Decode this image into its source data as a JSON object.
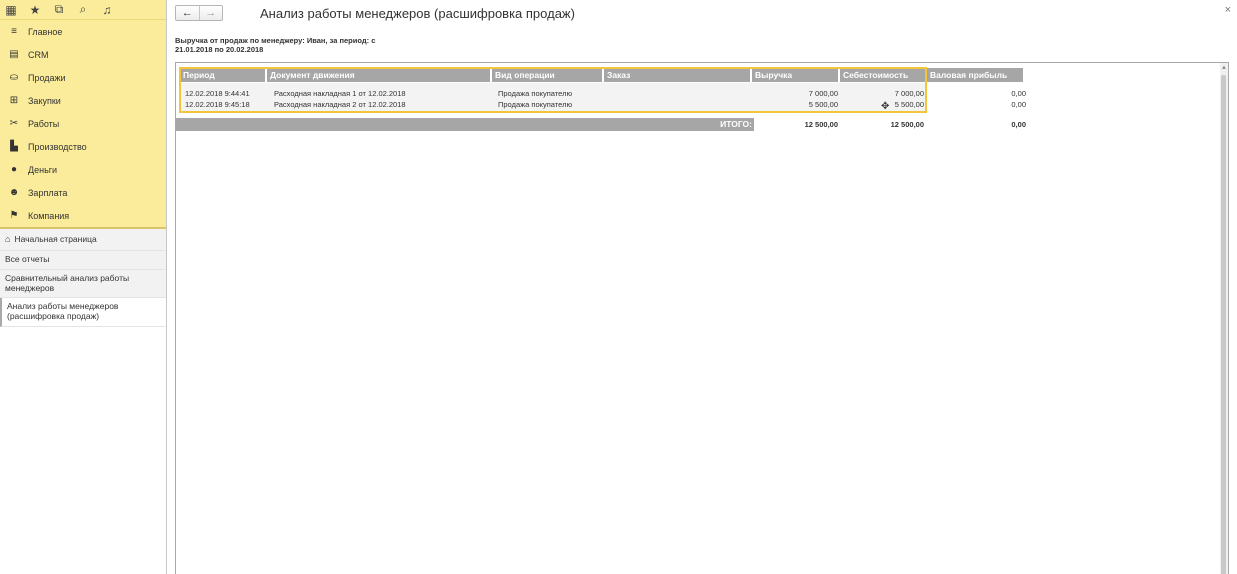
{
  "topbar": {
    "icons": [
      "apps-grid-icon",
      "star-icon",
      "history-icon",
      "search-icon",
      "bell-icon"
    ]
  },
  "sidebar": {
    "sections": [
      {
        "label": "Главное",
        "icon": "menu-icon"
      },
      {
        "label": "CRM",
        "icon": "crm-icon"
      },
      {
        "label": "Продажи",
        "icon": "sales-icon"
      },
      {
        "label": "Закупки",
        "icon": "cart-icon"
      },
      {
        "label": "Работы",
        "icon": "tools-icon"
      },
      {
        "label": "Производство",
        "icon": "factory-icon"
      },
      {
        "label": "Деньги",
        "icon": "money-icon"
      },
      {
        "label": "Зарплата",
        "icon": "people-icon"
      },
      {
        "label": "Компания",
        "icon": "flag-icon"
      }
    ],
    "open_windows": {
      "home": "Начальная страница",
      "items": [
        "Все отчеты",
        "Сравнительный анализ работы менеджеров",
        "Анализ работы менеджеров (расшифровка продаж)"
      ]
    }
  },
  "page": {
    "title": "Анализ работы менеджеров (расшифровка продаж)",
    "back": "←",
    "forward": "→",
    "close": "×"
  },
  "report": {
    "header_line1": "Выручка от продаж по менеджеру: Иван, за период: с",
    "header_line2": "21.01.2018 по 20.02.2018",
    "columns": [
      "Период",
      "Документ движения",
      "Вид операции",
      "Заказ",
      "Выручка",
      "Себестоимость",
      "Валовая прибыль"
    ],
    "rows": [
      {
        "period": "12.02.2018 9:44:41",
        "document": "Расходная накладная 1 от 12.02.2018",
        "operation": "Продажа покупателю",
        "order": "",
        "revenue": "7 000,00",
        "cost": "7 000,00",
        "profit": "0,00"
      },
      {
        "period": "12.02.2018 9:45:18",
        "document": "Расходная накладная 2 от 12.02.2018",
        "operation": "Продажа покупателю",
        "order": "",
        "revenue": "5 500,00",
        "cost": "5 500,00",
        "profit": "0,00"
      }
    ],
    "total_label": "ИТОГО:",
    "total_revenue": "12 500,00",
    "total_cost": "12 500,00",
    "total_profit": "0,00"
  },
  "colors": {
    "sidebar_bg": "#fbec9b",
    "header_gray": "#a6a6a6",
    "selection": "#f3c53b"
  }
}
